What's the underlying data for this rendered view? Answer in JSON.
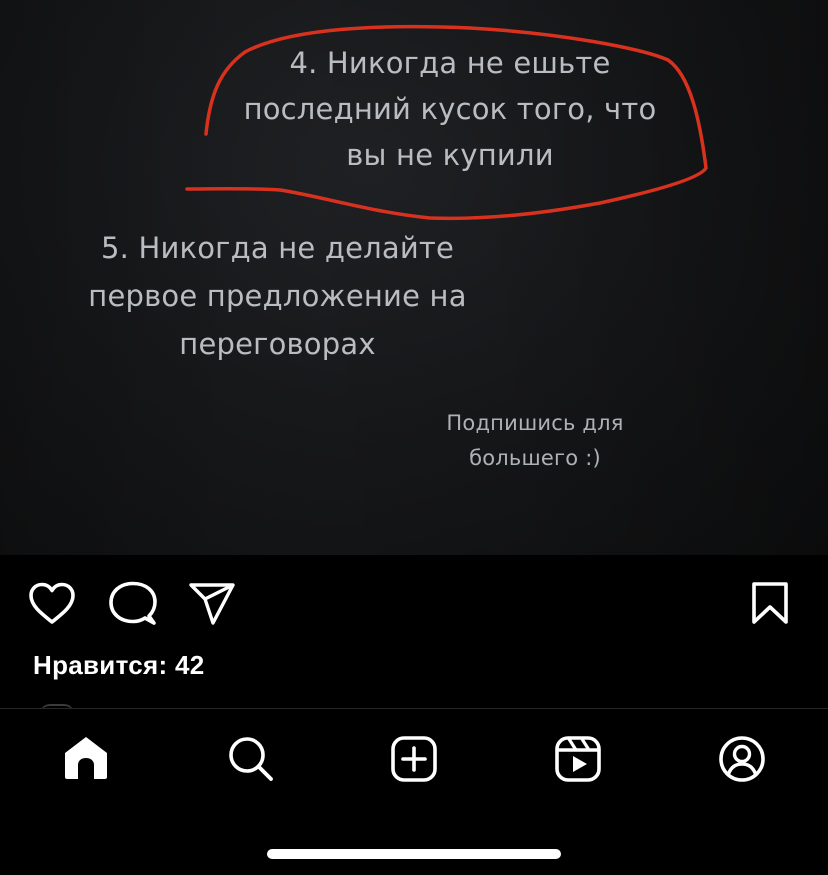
{
  "post": {
    "video_text": {
      "tip_4": "4. Никогда не ешьте\nпоследний кусок того, что\nвы не купили",
      "tip_5": "5. Никогда не делайте\nпервое предложение на\nпереговорах",
      "subscribe_cta": "Подпишись для\nбольшего :)"
    },
    "annotation_color": "#d8321f",
    "actions": {
      "like_icon": "heart-icon",
      "comment_icon": "comment-icon",
      "share_icon": "paper-plane-icon",
      "save_icon": "bookmark-icon"
    },
    "likes_text": "Нравится: 42"
  },
  "tab_bar": {
    "items": [
      {
        "name": "home",
        "icon": "home-icon",
        "active": true
      },
      {
        "name": "search",
        "icon": "search-icon"
      },
      {
        "name": "create",
        "icon": "plus-square-icon"
      },
      {
        "name": "reels",
        "icon": "reels-icon"
      },
      {
        "name": "profile",
        "icon": "profile-icon"
      }
    ]
  },
  "colors": {
    "background": "#000000",
    "video_text": "#b9bcc0",
    "icon": "#ffffff"
  }
}
